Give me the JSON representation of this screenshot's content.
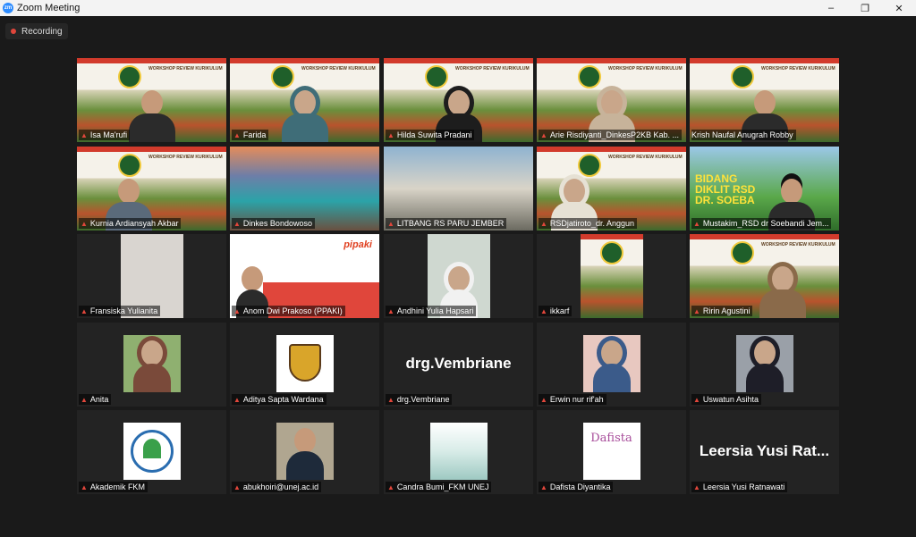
{
  "titlebar": {
    "app_icon": "zm",
    "title": "Zoom Meeting",
    "minimize_icon": "–",
    "maximize_icon": "❐",
    "close_icon": "✕"
  },
  "recording": {
    "label": "Recording"
  },
  "banner_text": "WORKSHOP REVIEW KURIKULUM",
  "participants": [
    {
      "name": "Isa Ma'rufi"
    },
    {
      "name": "Farida"
    },
    {
      "name": "Hilda Suwita Pradani"
    },
    {
      "name": "Arie Risdiyanti_DinkesP2KB Kab. ..."
    },
    {
      "name": "Krish Naufal Anugrah Robby"
    },
    {
      "name": "Kurnia Ardiansyah Akbar"
    },
    {
      "name": "Dinkes Bondowoso"
    },
    {
      "name": "LITBANG RS PARU JEMBER"
    },
    {
      "name": "RSDjatiroto_dr. Anggun"
    },
    {
      "name": "Mustakim_RSD dr Soebandi Jem..."
    },
    {
      "name": "Fransiska Yulianita"
    },
    {
      "name": "Anom Dwi Prakoso (PPAKI)"
    },
    {
      "name": "Andhini Yulia Hapsari"
    },
    {
      "name": "ikkarf"
    },
    {
      "name": "Ririn Agustini"
    },
    {
      "name": "Anita"
    },
    {
      "name": "Aditya Sapta Wardana"
    },
    {
      "name": "drg.Vembriane",
      "display": "drg.Vembriane"
    },
    {
      "name": "Erwin nur rif'ah"
    },
    {
      "name": "Uswatun Asihta"
    },
    {
      "name": "Akademik FKM"
    },
    {
      "name": "abukhoiri@unej.ac.id"
    },
    {
      "name": "Candra Bumi_FKM UNEJ"
    },
    {
      "name": "Dafista Diyantika",
      "avatar_text": "Dafista"
    },
    {
      "name": "Leersia Yusi Ratnawati",
      "display": "Leersia Yusi Rat..."
    }
  ],
  "diklat_text": "BIDANG DIKLIT RSD DR. SOEBA",
  "aipkind_text": "pipaki",
  "colors": {
    "active_speaker": "#d6e34a",
    "muted_mic": "#e0463b",
    "recording_dot": "#e0463b"
  }
}
